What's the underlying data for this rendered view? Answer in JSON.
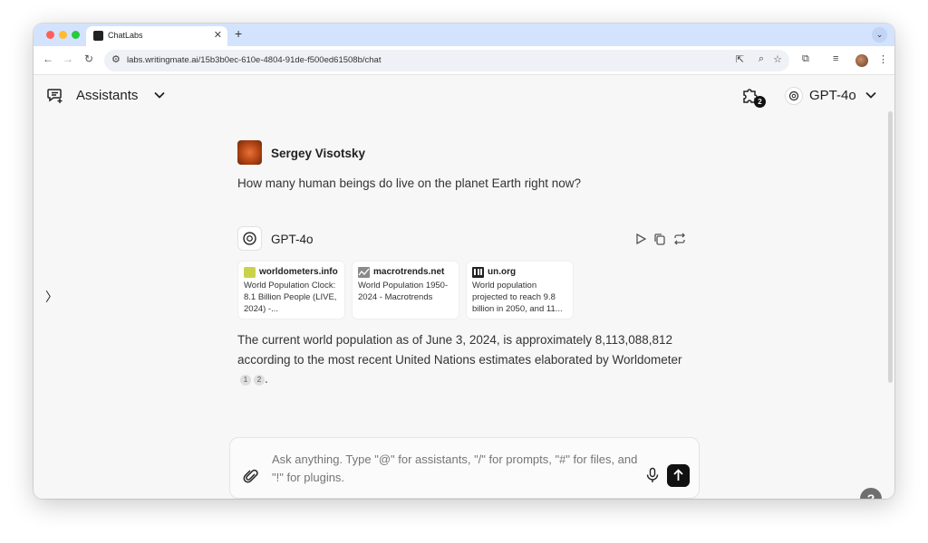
{
  "browser": {
    "tab_title": "ChatLabs",
    "url": "labs.writingmate.ai/15b3b0ec-610e-4804-91de-f500ed61508b/chat",
    "traffic_colors": [
      "#ff5f57",
      "#febc2e",
      "#28c840"
    ]
  },
  "header": {
    "assistants_label": "Assistants",
    "plugins_count": "2",
    "model_label": "GPT-4o"
  },
  "conversation": {
    "user_name": "Sergey Visotsky",
    "question": "How many human beings do live on the planet Earth right now?",
    "assistant_name": "GPT-4o",
    "sources": [
      {
        "site": "worldometers.info",
        "snippet": "World Population Clock: 8.1 Billion People (LIVE, 2024) -...",
        "icon": "worldometers-icon"
      },
      {
        "site": "macrotrends.net",
        "snippet": "World Population 1950-2024 - Macrotrends",
        "icon": "macrotrends-icon"
      },
      {
        "site": "un.org",
        "snippet": "World population projected to reach 9.8 billion in 2050, and 11...",
        "icon": "un-icon"
      }
    ],
    "answer_text": "The current world population as of June 3, 2024, is approximately 8,113,088,812 according to the most recent United Nations estimates elaborated by Worldometer",
    "citations": [
      "1",
      "2"
    ],
    "answer_end": "."
  },
  "composer": {
    "placeholder": "Ask anything. Type \"@\" for assistants, \"/\" for prompts, \"#\" for files, and \"!\" for plugins."
  },
  "help_label": "?"
}
